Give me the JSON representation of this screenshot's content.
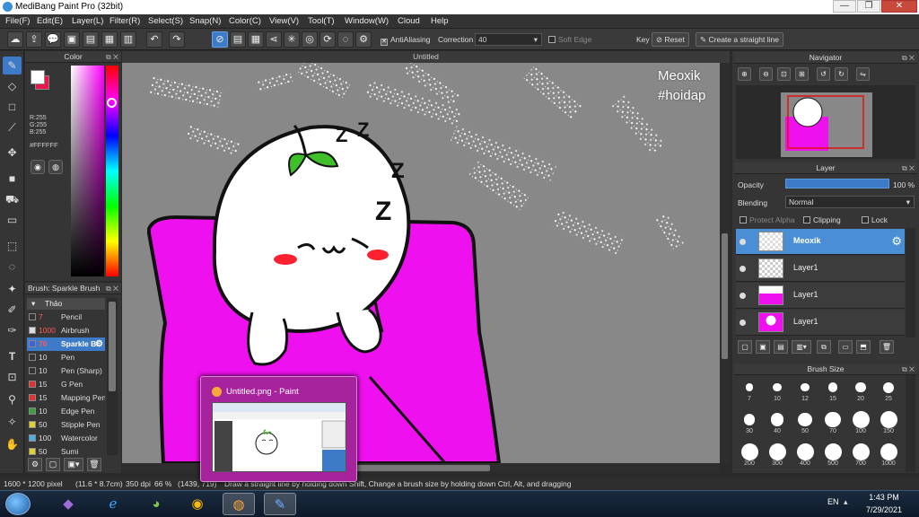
{
  "window": {
    "title": "MediBang Paint Pro (32bit)",
    "min_glyph": "—",
    "max_glyph": "❐",
    "close_glyph": "✕"
  },
  "menu": [
    "File(F)",
    "Edit(E)",
    "Layer(L)",
    "Filter(R)",
    "Select(S)",
    "Snap(N)",
    "Color(C)",
    "View(V)",
    "Tool(T)",
    "Window(W)",
    "Cloud",
    "Help"
  ],
  "toolbar": {
    "antialiasing_label": "AntiAliasing",
    "antialiasing_checked": true,
    "correction_label": "Correction",
    "correction_value": "40",
    "soft_edge_label": "Soft Edge",
    "soft_edge_checked": false,
    "key_label": "Key",
    "reset_label": "Reset",
    "straight_line_label": "Create a straight line",
    "icons": [
      "cloud-icon",
      "share-icon",
      "comment-icon",
      "save-icon",
      "export-icon",
      "grid-menu-icon",
      "film-icon",
      "undo-icon",
      "redo-icon"
    ]
  },
  "color_panel": {
    "title": "Color",
    "foreground": "#FFFFFF",
    "background": "#E8174D",
    "r_label": "R:255",
    "g_label": "G:255",
    "b_label": "B:255",
    "hex_label": "#FFFFFF"
  },
  "brush_panel": {
    "title": "Brush: Sparkle Brush",
    "group": "Thảo",
    "items": [
      {
        "size": "7",
        "name": "Pencil",
        "color": "#333333",
        "size_red": true
      },
      {
        "size": "1000",
        "name": "Airbrush",
        "color": "#dddddd",
        "size_red": true
      },
      {
        "size": "70",
        "name": "Sparkle Br",
        "color": "#3d5fe0",
        "size_red": true,
        "active": true
      },
      {
        "size": "10",
        "name": "Pen",
        "color": "#333333"
      },
      {
        "size": "10",
        "name": "Pen (Sharp)",
        "color": "#333333"
      },
      {
        "size": "15",
        "name": "G Pen",
        "color": "#e53030"
      },
      {
        "size": "15",
        "name": "Mapping Pen",
        "color": "#e53030"
      },
      {
        "size": "10",
        "name": "Edge Pen",
        "color": "#3aa03a"
      },
      {
        "size": "50",
        "name": "Stipple Pen",
        "color": "#e0d030"
      },
      {
        "size": "100",
        "name": "Watercolor",
        "color": "#4ab0e0"
      },
      {
        "size": "50",
        "name": "Sumi",
        "color": "#e0d030"
      }
    ]
  },
  "canvas": {
    "tab_title": "Untitled",
    "watermark_line1": "Meoxik",
    "watermark_line2": "#hoidap",
    "zzz": [
      "Z",
      "Z",
      "Z",
      "Z"
    ]
  },
  "navigator": {
    "title": "Navigator"
  },
  "layer_panel": {
    "title": "Layer",
    "opacity_label": "Opacity",
    "opacity_value": "100 %",
    "opacity_fraction": 1.0,
    "blending_label": "Blending",
    "blending_value": "Normal",
    "protect_alpha_label": "Protect Alpha",
    "clipping_label": "Clipping",
    "lock_label": "Lock",
    "layers": [
      {
        "name": "Meoxik",
        "active": true
      },
      {
        "name": "Layer1"
      },
      {
        "name": "Layer1"
      },
      {
        "name": "Layer1"
      }
    ]
  },
  "brush_size_panel": {
    "title": "Brush Size",
    "sizes": [
      "7",
      "10",
      "12",
      "15",
      "20",
      "25",
      "30",
      "40",
      "50",
      "70",
      "100",
      "150",
      "200",
      "300",
      "400",
      "500",
      "700",
      "1000"
    ]
  },
  "status_bar": {
    "image_size": "1600 * 1200 pixel",
    "physical_size": "(11.6 * 8.7cm)",
    "dpi": "350 dpi",
    "zoom": "66 %",
    "coords": "(1439, 719)",
    "hint": "Draw a straight line by holding down Shift, Change a brush size by holding down Ctrl, Alt, and dragging"
  },
  "taskbar": {
    "language": "EN",
    "time": "1:43 PM",
    "date": "7/29/2021",
    "apps": [
      "visual-studio-icon",
      "internet-explorer-icon",
      "coccoc-browser-icon",
      "chrome-icon",
      "paint-icon",
      "medibang-icon"
    ]
  },
  "preview_popup": {
    "title": "Untitled.png - Paint"
  }
}
